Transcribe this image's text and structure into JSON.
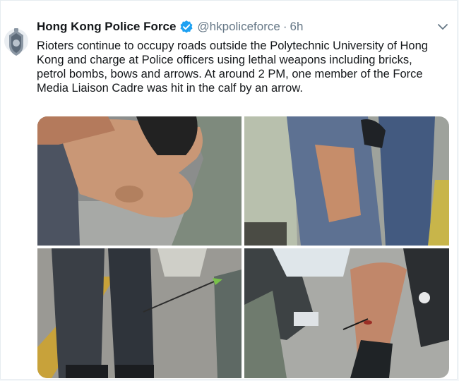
{
  "tweet": {
    "account_name": "Hong Kong Police Force",
    "handle": "@hkpoliceforce",
    "separator": "·",
    "time": "6h",
    "text_lines": [
      "Rioters continue to occupy roads outside the Polytechnic University of Hong",
      "Kong and charge at Police officers using lethal weapons including bricks,",
      "petrol bombs, bows and arrows. At around 2 PM, one member of the Force",
      "Media Liaison Cadre was hit in the calf by an arrow."
    ]
  },
  "icons": {
    "avatar": "police-crest-icon",
    "verified": "verified-badge-icon",
    "menu": "chevron-down-icon"
  },
  "colors": {
    "text": "#14171a",
    "secondary": "#657786",
    "verified": "#1da1f2",
    "border": "#e6ecf0"
  },
  "media": [
    {
      "name": "photo-wound-closeup"
    },
    {
      "name": "photo-torn-trouser-leg"
    },
    {
      "name": "photo-arrow-in-leg-standing"
    },
    {
      "name": "photo-arrow-in-calf"
    }
  ]
}
